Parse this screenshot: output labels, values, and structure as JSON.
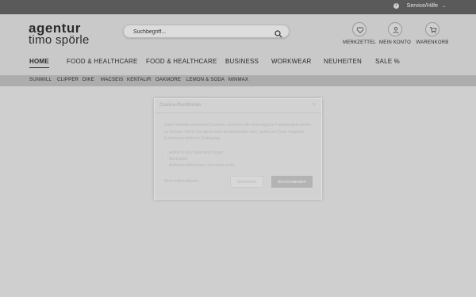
{
  "topbar": {
    "service_label": "Service/Hilfe",
    "info_icon": "info-icon",
    "chevron_icon": "chevron-down-icon"
  },
  "logo": {
    "line1": "agentur",
    "line2": "timo spörle"
  },
  "search": {
    "placeholder": "Suchbegriff...",
    "icon": "search-icon"
  },
  "header_icons": [
    {
      "label": "MERKZETTEL",
      "icon": "heart-icon"
    },
    {
      "label": "MEIN KONTO",
      "icon": "user-icon"
    },
    {
      "label": "WARENKORB",
      "icon": "cart-icon"
    }
  ],
  "nav": {
    "items": [
      "HOME",
      "FOOD & HEALTHCARE",
      "FOOD & HEALTHCARE",
      "BUSINESS",
      "WORKWEAR",
      "NEUHEITEN",
      "SALE %"
    ],
    "active": "HOME"
  },
  "subnav": {
    "brands": [
      "SUNWILL",
      "CLIPPER",
      "DIKE",
      "MACSEIS",
      "KENTALIR",
      "OAKMORE",
      "LEMON & SODA",
      "MINMAX"
    ]
  },
  "cookie_modal": {
    "title": "Cookie-Richtlinien",
    "close": "×",
    "text": "Diese Website verwendet Cookies, um Ihnen die bestmögliche Funktionalität bieten zu können. Wenn Sie damit nicht einverstanden sind, stellen wir Ihnen folgende Funktionen nicht zur Verfügung:",
    "list": [
      "Artikel in den Warenkorb legen",
      "Merkzettel",
      "Artikelempfehlungen und vieles mehr"
    ],
    "more_info": "Mehr Informationen",
    "deny_label": "Schließen",
    "accept_label": "Einverstanden"
  },
  "colors": {
    "topbar": "#5a5a5a",
    "overlay_background": "#cfcfcf",
    "subnav": "#adadad"
  }
}
